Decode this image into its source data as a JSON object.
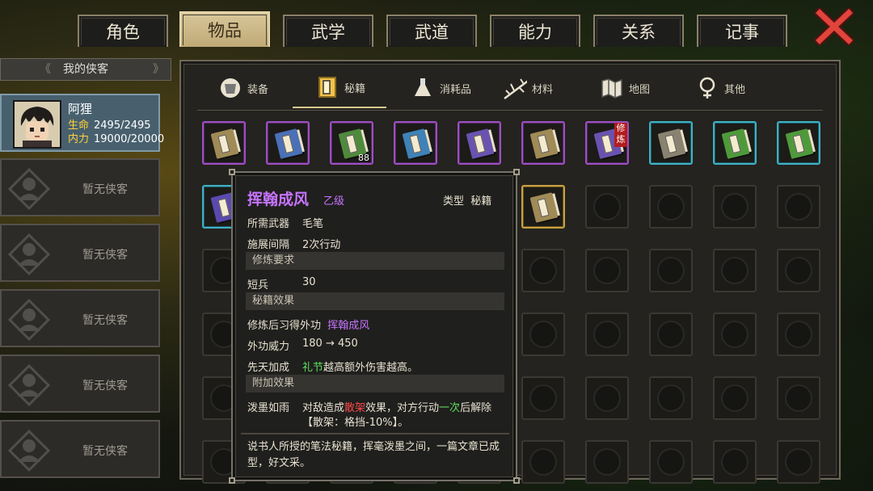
{
  "tabs": [
    {
      "label": "角色",
      "active": false
    },
    {
      "label": "物品",
      "active": true
    },
    {
      "label": "武学",
      "active": false
    },
    {
      "label": "武道",
      "active": false
    },
    {
      "label": "能力",
      "active": false
    },
    {
      "label": "关系",
      "active": false
    },
    {
      "label": "记事",
      "active": false
    }
  ],
  "close_icon": "close-x-icon",
  "sidebar": {
    "header": "我的侠客",
    "active_character": {
      "name": "阿狸",
      "hp_label": "生命",
      "hp_value": "2495/2495",
      "mp_label": "内力",
      "mp_value": "19000/20000"
    },
    "empty_label": "暂无侠客",
    "empty_slots": 5
  },
  "subtabs": [
    {
      "label": "装备",
      "icon": "armor-icon",
      "active": false
    },
    {
      "label": "秘籍",
      "icon": "book-icon",
      "active": true
    },
    {
      "label": "消耗品",
      "icon": "potion-icon",
      "active": false
    },
    {
      "label": "材料",
      "icon": "herb-icon",
      "active": false
    },
    {
      "label": "地图",
      "icon": "map-icon",
      "active": false
    },
    {
      "label": "其他",
      "icon": "other-icon",
      "active": false
    }
  ],
  "inventory_rows": [
    [
      {
        "rarity": "purple",
        "color": "#a08a55"
      },
      {
        "rarity": "purple",
        "color": "#4a70b8"
      },
      {
        "rarity": "purple",
        "color": "#4e8a3c",
        "count": "88"
      },
      {
        "rarity": "purple",
        "color": "#3e82b8"
      },
      {
        "rarity": "purple",
        "color": "#6a52b0"
      },
      {
        "rarity": "purple",
        "color": "#a08a55"
      },
      {
        "rarity": "purple",
        "color": "#6a52b0",
        "tag": "修炼"
      },
      {
        "rarity": "cyan",
        "color": "#8a8270"
      },
      {
        "rarity": "cyan",
        "color": "#4e9a3a"
      },
      {
        "rarity": "cyan",
        "color": "#4e9a3a"
      }
    ],
    [
      {
        "rarity": "cyan",
        "color": "#5a4ab0"
      },
      null,
      null,
      null,
      null,
      {
        "rarity": "gold",
        "color": "#a08a55"
      },
      null,
      null,
      null,
      null
    ]
  ],
  "tooltip": {
    "title": "挥翰成风",
    "grade": "乙级",
    "type_label": "类型",
    "type_value": "秘籍",
    "weapon_label": "所需武器",
    "weapon_value": "毛笔",
    "interval_label": "施展间隔",
    "interval_value": "2次行动",
    "req_section": "修炼要求",
    "req_label": "短兵",
    "req_value": "30",
    "effect_section": "秘籍效果",
    "learn_label": "修炼后习得外功",
    "learn_value": "挥翰成风",
    "power_label": "外功威力",
    "power_value": "180 → 450",
    "innate_label": "先天加成",
    "innate_key": "礼节",
    "innate_text": "越高额外伤害越高。",
    "extra_section": "附加效果",
    "extra_label": "泼墨如雨",
    "extra_pre": "对敌造成",
    "extra_status": "散架",
    "extra_mid": "效果，对方行动",
    "extra_count": "一次",
    "extra_post": "后解除",
    "extra_line2": "【散架：格挡-10%】。",
    "description": "说书人所授的笔法秘籍，挥毫泼墨之间，一篇文章已成型，好文采。"
  }
}
